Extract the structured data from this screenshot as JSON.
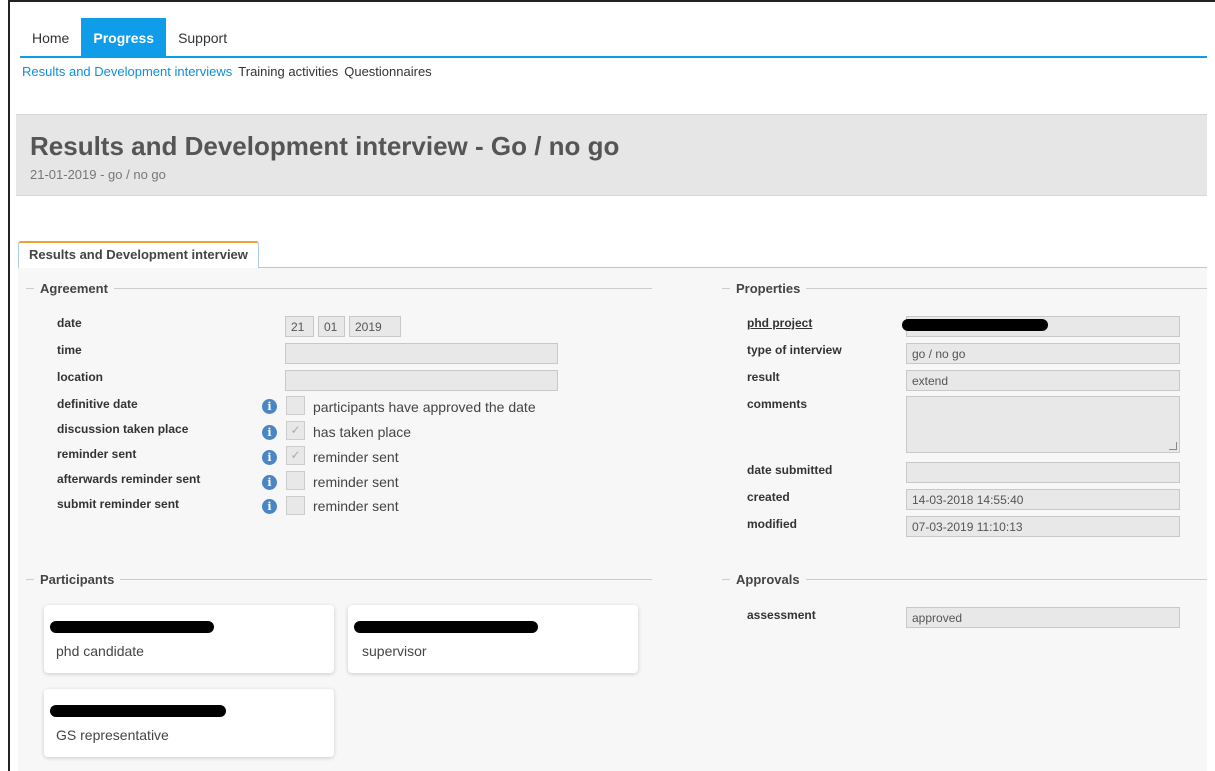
{
  "nav": {
    "tabs": [
      "Home",
      "Progress",
      "Support"
    ],
    "active_tab": "Progress",
    "subtabs": [
      "Results and Development interviews",
      "Training activities",
      "Questionnaires"
    ],
    "active_subtab": "Results and Development interviews"
  },
  "header": {
    "title": "Results and Development interview - Go / no go",
    "subtitle": "21-01-2019 - go / no go"
  },
  "tab": {
    "label": "Results and Development interview"
  },
  "agreement": {
    "legend": "Agreement",
    "date_label": "date",
    "date_day": "21",
    "date_month": "01",
    "date_year": "2019",
    "time_label": "time",
    "time_value": "",
    "location_label": "location",
    "location_value": "",
    "definitive_date_label": "definitive date",
    "definitive_date_text": "participants have approved the date",
    "definitive_date_checked": false,
    "discussion_label": "discussion taken place",
    "discussion_text": "has taken place",
    "discussion_checked": true,
    "reminder_label": "reminder sent",
    "reminder_text": "reminder sent",
    "reminder_checked": true,
    "afterwards_label": "afterwards reminder sent",
    "afterwards_text": "reminder sent",
    "afterwards_checked": false,
    "submit_label": "submit reminder sent",
    "submit_text": "reminder sent",
    "submit_checked": false,
    "info_icon_glyph": "i"
  },
  "properties": {
    "legend": "Properties",
    "phd_project_label": "phd project",
    "phd_project_value": "",
    "type_label": "type of interview",
    "type_value": "go / no go",
    "result_label": "result",
    "result_value": "extend",
    "comments_label": "comments",
    "comments_value": "",
    "date_submitted_label": "date submitted",
    "date_submitted_value": "",
    "created_label": "created",
    "created_value": "14-03-2018 14:55:40",
    "modified_label": "modified",
    "modified_value": "07-03-2019 11:10:13"
  },
  "participants": {
    "legend": "Participants",
    "cards": [
      {
        "role": "phd candidate"
      },
      {
        "role": "supervisor"
      },
      {
        "role": "GS representative"
      }
    ]
  },
  "approvals": {
    "legend": "Approvals",
    "assessment_label": "assessment",
    "assessment_value": "approved"
  },
  "colors": {
    "accent": "#0f9ce8",
    "tab_highlight": "#f0a030",
    "info_icon": "#4a86c5"
  }
}
